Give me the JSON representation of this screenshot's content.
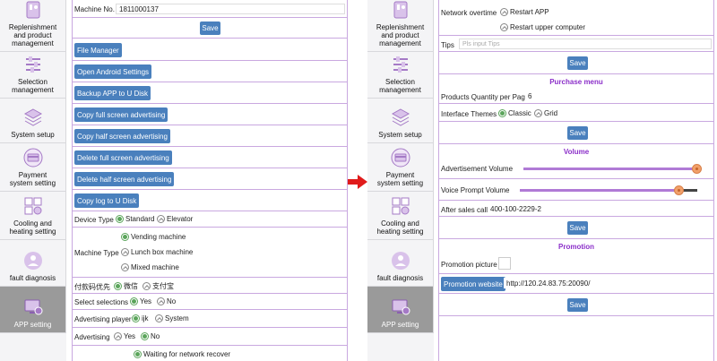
{
  "sidebar": {
    "items": [
      {
        "label_line1": "Replenishment",
        "label_line2": "and product",
        "label_line3": "management",
        "icon": "replenishment-icon"
      },
      {
        "label_line1": "Selection",
        "label_line2": "management",
        "icon": "selection-icon"
      },
      {
        "label_line1": "System setup",
        "icon": "layers-icon"
      },
      {
        "label_line1": "Payment",
        "label_line2": "system setting",
        "icon": "payment-icon"
      },
      {
        "label_line1": "Cooling and",
        "label_line2": "heating setting",
        "icon": "cooling-icon"
      },
      {
        "label_line1": "fault diagnosis",
        "icon": "fault-icon"
      },
      {
        "label_line1": "APP setting",
        "icon": "app-setting-icon",
        "active": true
      }
    ]
  },
  "left_panel": {
    "machine_no_label": "Machine No.",
    "machine_no_value": "1811000137",
    "save_label": "Save",
    "buttons": [
      "File Manager",
      "Open Android Settings",
      "Backup APP to U Disk",
      "Copy full screen advertising",
      "Copy half screen advertising",
      "Delete full screen advertising",
      "Delete half screen advertising",
      "Copy log to U Disk"
    ],
    "device_type_label": "Device Type",
    "device_type_options": [
      "Standard",
      "Elevator"
    ],
    "machine_type_label": "Machine Type",
    "machine_type_options": [
      "Vending machine",
      "Lunch box machine",
      "Mixed machine"
    ],
    "pay_code_label": "付款码优先",
    "pay_code_options": [
      "微信",
      "支付宝"
    ],
    "select_selections_label": "Select selections",
    "select_selections_options": [
      "Yes",
      "No"
    ],
    "advertising_player_label": "Advertising player",
    "advertising_player_options": [
      "ijk",
      "System"
    ],
    "advertising_label": "Advertising",
    "advertising_options": [
      "Yes",
      "No"
    ],
    "waiting_label": "Waiting for network recover"
  },
  "right_panel": {
    "network_overtime_label": "Network overtime",
    "network_overtime_options": [
      "Restart APP",
      "Restart upper computer"
    ],
    "tips_label": "Tips",
    "tips_placeholder": "Pls input Tips",
    "save_label": "Save",
    "purchase_menu_title": "Purchase menu",
    "products_qty_label": "Products Quantity per Page",
    "products_qty_value": "6",
    "interface_themes_label": "Interface Themes",
    "interface_themes_options": [
      "Classic",
      "Grid"
    ],
    "volume_title": "Volume",
    "ad_volume_label": "Advertisement Volume",
    "ad_volume_level": 1.0,
    "voice_volume_label": "Voice Prompt Volume",
    "voice_volume_level": 0.9,
    "after_sales_label": "After sales call",
    "after_sales_value": "400-100-2229-2",
    "promotion_title": "Promotion",
    "promotion_picture_label": "Promotion picture",
    "promotion_website_label": "Promotion website",
    "promotion_website_value": "http://120.24.83.75:20090/"
  },
  "colors": {
    "button_blue": "#4a80bd",
    "section_purple": "#8b2fc9",
    "radio_green": "#5ba55b",
    "arrow_red": "#e01b1b",
    "active_nav": "#9a9a9a"
  }
}
